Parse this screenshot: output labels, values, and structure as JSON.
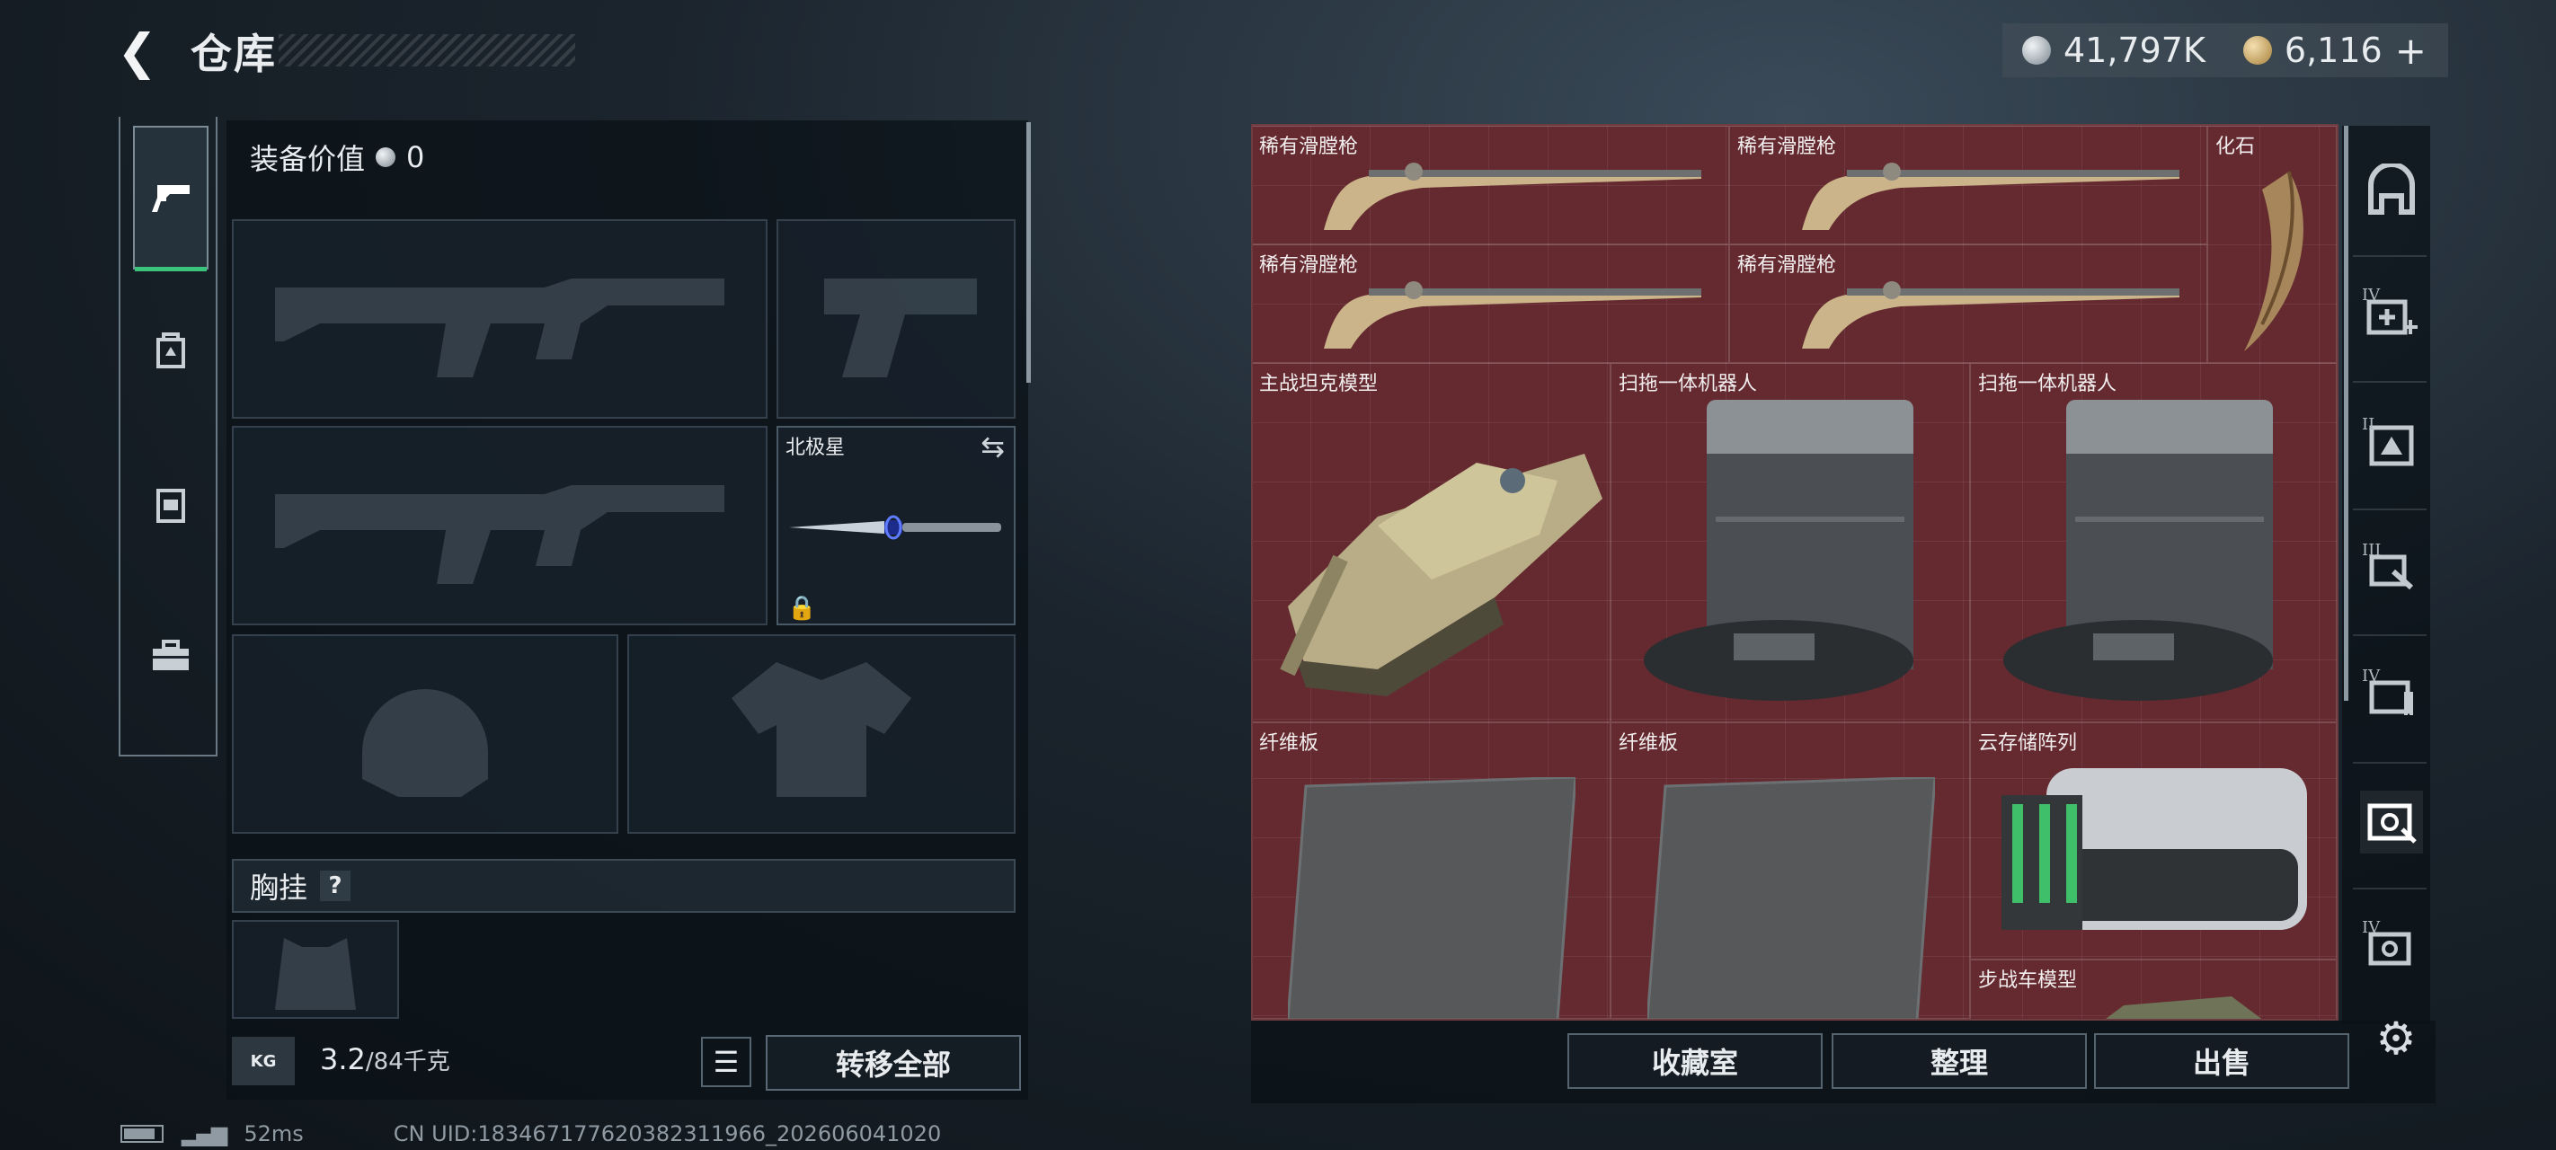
{
  "header": {
    "back_icon": "chevron-left-icon",
    "title": "仓库",
    "silver_currency": "41,797K",
    "gold_currency": "6,116",
    "gold_add": "+"
  },
  "left_tabs": [
    {
      "name": "pistol-icon",
      "active": true
    },
    {
      "name": "ammo-box-icon",
      "active": false
    },
    {
      "name": "container-icon",
      "active": false
    },
    {
      "name": "toolbox-icon",
      "active": false
    }
  ],
  "loadout": {
    "equip_value_label": "装备价值",
    "equip_value": "0",
    "melee_name": "北极星",
    "chest_rig_label": "胸挂",
    "chest_rig_help": "?",
    "weight_icon_text": "KG",
    "weight_value": "3.2",
    "weight_max": "/84千克",
    "transfer_all": "转移全部"
  },
  "status": {
    "ping": "52ms",
    "uid": "CN UID:18346717762038231196​6_202606041020"
  },
  "stash": {
    "items": [
      {
        "label": "稀有滑膛枪",
        "type": "musket"
      },
      {
        "label": "稀有滑膛枪",
        "type": "musket"
      },
      {
        "label": "化石",
        "type": "fossil"
      },
      {
        "label": "稀有滑膛枪",
        "type": "musket"
      },
      {
        "label": "稀有滑膛枪",
        "type": "musket"
      },
      {
        "label": "主战坦克模型",
        "type": "tank"
      },
      {
        "label": "扫拖一体机器人",
        "type": "robot"
      },
      {
        "label": "扫拖一体机器人",
        "type": "robot"
      },
      {
        "label": "纤维板",
        "type": "board"
      },
      {
        "label": "纤维板",
        "type": "board"
      },
      {
        "label": "云存储阵列",
        "type": "server"
      },
      {
        "label": "步战车模型",
        "type": "ifv"
      }
    ],
    "actions": {
      "collection": "收藏室",
      "sort": "整理",
      "sell": "出售"
    }
  },
  "right_sidebar": [
    {
      "icon": "vault-icon",
      "tier": ""
    },
    {
      "icon": "medkit-add-icon",
      "tier": "IV"
    },
    {
      "icon": "tier-ii-item-icon",
      "tier": "II"
    },
    {
      "icon": "tier-iii-item-icon",
      "tier": "III"
    },
    {
      "icon": "tier-iv-item-icon",
      "tier": "IV"
    },
    {
      "icon": "collectible-icon",
      "tier": ""
    },
    {
      "icon": "tier-iv-collectible-icon",
      "tier": "IV"
    },
    {
      "icon": "gear-icon",
      "tier": ""
    }
  ],
  "colors": {
    "stash_bg": "#642a30",
    "accent_green": "#3ac37a"
  }
}
